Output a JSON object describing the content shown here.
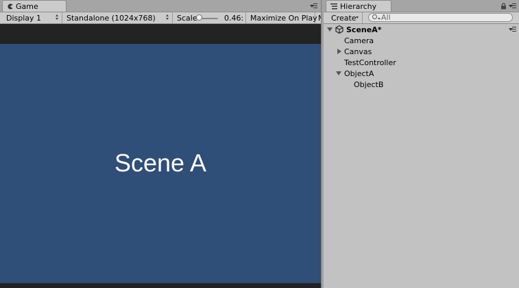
{
  "game": {
    "tab_label": "Game",
    "toolbar": {
      "display": "Display 1",
      "resolution": "Standalone (1024x768)",
      "scale_label": "Scale",
      "scale_value": "0.46:",
      "maximize": "Maximize On Play",
      "next_item": "M"
    },
    "view_text": "Scene A",
    "view_color": "#2f4e78"
  },
  "hierarchy": {
    "tab_label": "Hierarchy",
    "create_label": "Create",
    "search_placeholder": "All",
    "scene_name": "SceneA*",
    "items": [
      {
        "label": "Camera",
        "indent": 0,
        "expander": "none"
      },
      {
        "label": "Canvas",
        "indent": 0,
        "expander": "collapsed"
      },
      {
        "label": "TestController",
        "indent": 0,
        "expander": "none"
      },
      {
        "label": "ObjectA",
        "indent": 0,
        "expander": "expanded"
      },
      {
        "label": "ObjectB",
        "indent": 1,
        "expander": "none"
      }
    ]
  }
}
